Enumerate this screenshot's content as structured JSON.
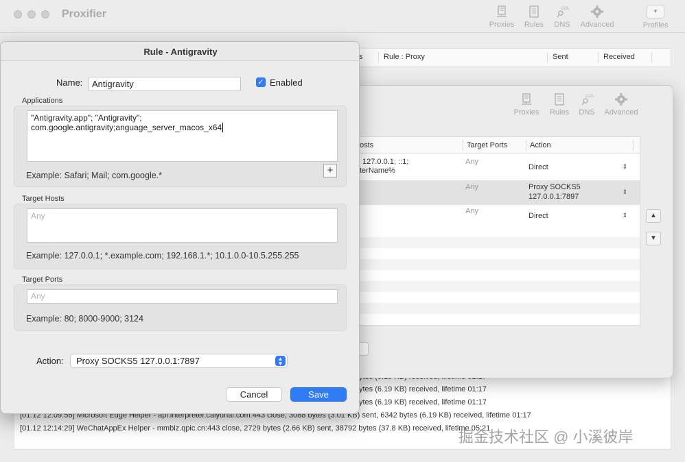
{
  "main": {
    "title": "Proxifier",
    "toolbar": [
      "Proxies",
      "Rules",
      "DNS",
      "Advanced",
      "Profiles"
    ],
    "columns": [
      "s",
      "Rule : Proxy",
      "Sent",
      "Received"
    ],
    "log": [
      "ytes (6.19 KB) received, lifetime 01:17",
      "ytes (6.19 KB) received, lifetime 01:17",
      "ytes (6.19 KB) received, lifetime 01:17",
      "[01.12 12:09:56] Microsoft Edge Helper - api.interpreter.caiyunai.com:443 close, 3088 bytes (3.01 KB) sent, 6342 bytes (6.19 KB) received, lifetime 01:17",
      "[01.12 12:14:29] WeChatAppEx Helper - mmbiz.qpic.cn:443 close, 2729 bytes (2.66 KB) sent, 38792 bytes (37.8 KB) received, lifetime 05:21"
    ]
  },
  "rules": {
    "toolbar": [
      "Proxies",
      "Rules",
      "DNS",
      "Advanced"
    ],
    "columns": [
      "osts",
      "Target Ports",
      "Action"
    ],
    "rows": [
      {
        "hosts": "127.0.0.1; ::1;",
        "hosts2": "terName%",
        "ports": "Any",
        "action": "Direct"
      },
      {
        "hosts": "",
        "hosts2": "",
        "ports": "Any",
        "action": "Proxy SOCKS5",
        "action2": "127.0.0.1:7897"
      },
      {
        "hosts": "",
        "hosts2": "",
        "ports": "Any",
        "action": "Direct"
      }
    ],
    "up": "▲",
    "down": "▼"
  },
  "sheet": {
    "title": "Rule - Antigravity",
    "name_label": "Name:",
    "name_value": "Antigravity",
    "enabled_label": "Enabled",
    "apps_label": "Applications",
    "apps_line1": "\"Antigravity.app\"; \"Antigravity\";",
    "apps_line2": "com.google.antigravity;anguage_server_macos_x64",
    "apps_example": "Example: Safari; Mail; com.google.*",
    "hosts_label": "Target Hosts",
    "hosts_placeholder": "Any",
    "hosts_example": "Example: 127.0.0.1; *.example.com; 192.168.1.*; 10.1.0.0-10.5.255.255",
    "ports_label": "Target Ports",
    "ports_placeholder": "Any",
    "ports_example": "Example: 80; 8000-9000; 3124",
    "action_label": "Action:",
    "action_value": "Proxy SOCKS5 127.0.0.1:7897",
    "cancel": "Cancel",
    "save": "Save",
    "plus": "+"
  },
  "watermark": "掘金技术社区 @ 小溪彼岸",
  "colors": {
    "accent": "#2f7cf6",
    "window_bg": "#ececec"
  }
}
